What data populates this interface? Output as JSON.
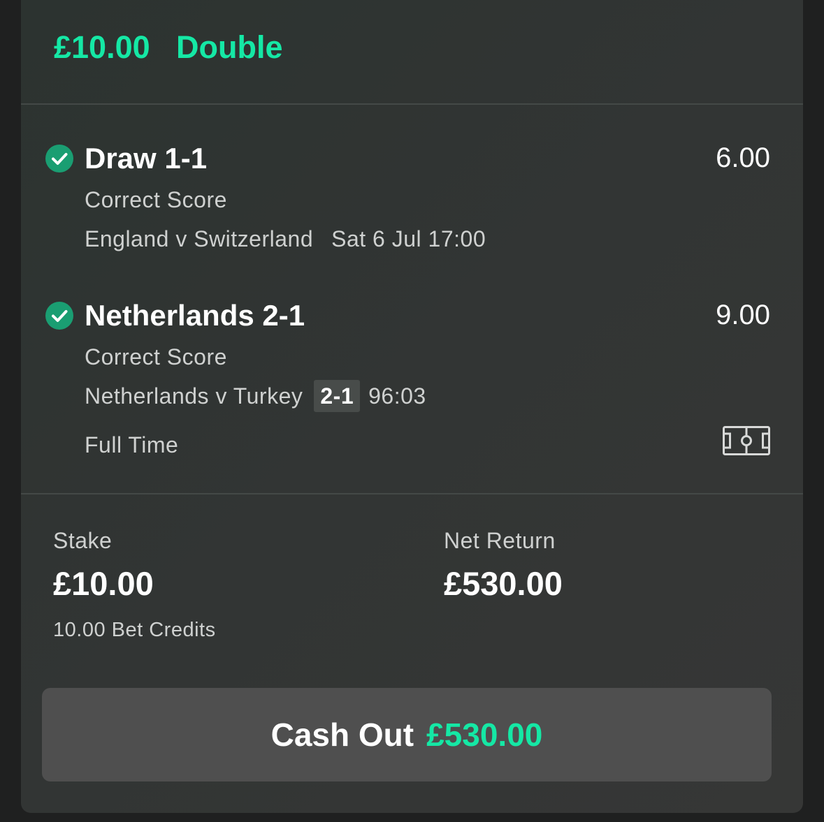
{
  "header": {
    "stake": "£10.00",
    "bet_type": "Double"
  },
  "selections": [
    {
      "status_icon": "check-circle-icon",
      "title": "Draw 1-1",
      "odds": "6.00",
      "market": "Correct Score",
      "event": "England v Switzerland",
      "kickoff": "Sat 6 Jul 17:00"
    },
    {
      "status_icon": "check-circle-icon",
      "title": "Netherlands 2-1",
      "odds": "9.00",
      "market": "Correct Score",
      "event": "Netherlands v Turkey",
      "score": "2-1",
      "clock": "96:03",
      "status": "Full Time",
      "extra_icon": "pitch-icon"
    }
  ],
  "summary": {
    "stake_label": "Stake",
    "stake_value": "£10.00",
    "credits": "10.00 Bet Credits",
    "return_label": "Net Return",
    "return_value": "£530.00"
  },
  "cashout": {
    "label": "Cash Out",
    "amount": "£530.00"
  },
  "colors": {
    "accent": "#15e8a5",
    "check": "#1a9e72",
    "card_bg": "#303533",
    "button_bg": "#4f4f4f"
  }
}
